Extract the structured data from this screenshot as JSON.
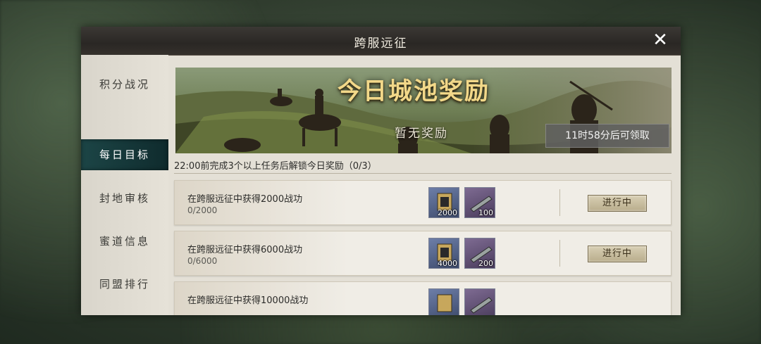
{
  "window": {
    "title": "跨服远征",
    "close_icon": "close-icon"
  },
  "sidebar": {
    "items": [
      {
        "label": "积分战况",
        "active": false
      },
      {
        "label": "每日目标",
        "active": true
      },
      {
        "label": "封地审核",
        "active": false
      },
      {
        "label": "蜜道信息",
        "active": false
      },
      {
        "label": "同盟排行",
        "active": false
      }
    ]
  },
  "banner": {
    "title": "今日城池奖励",
    "subtitle": "暂无奖励",
    "countdown": "11时58分后可领取"
  },
  "hint": "22:00前完成3个以上任务后解锁今日奖励（0/3）",
  "tasks": [
    {
      "name": "在跨服远征中获得2000战功",
      "progress": "0/2000",
      "status": "进行中",
      "rewards": [
        {
          "icon": "merit-token-icon",
          "amount": "2000",
          "color": "blue"
        },
        {
          "icon": "weapon-icon",
          "amount": "100",
          "color": "purple"
        }
      ]
    },
    {
      "name": "在跨服远征中获得6000战功",
      "progress": "0/6000",
      "status": "进行中",
      "rewards": [
        {
          "icon": "merit-token-icon",
          "amount": "4000",
          "color": "blue"
        },
        {
          "icon": "weapon-icon",
          "amount": "200",
          "color": "purple"
        }
      ]
    },
    {
      "name": "在跨服远征中获得10000战功",
      "progress": "",
      "status": "",
      "rewards": [
        {
          "icon": "merit-token-icon",
          "amount": "",
          "color": "blue"
        },
        {
          "icon": "weapon-icon",
          "amount": "",
          "color": "purple"
        }
      ]
    }
  ],
  "colors": {
    "active_tab": "#123537",
    "title_gold": "#f2d889",
    "panel_bg": "#e4e0d6"
  }
}
